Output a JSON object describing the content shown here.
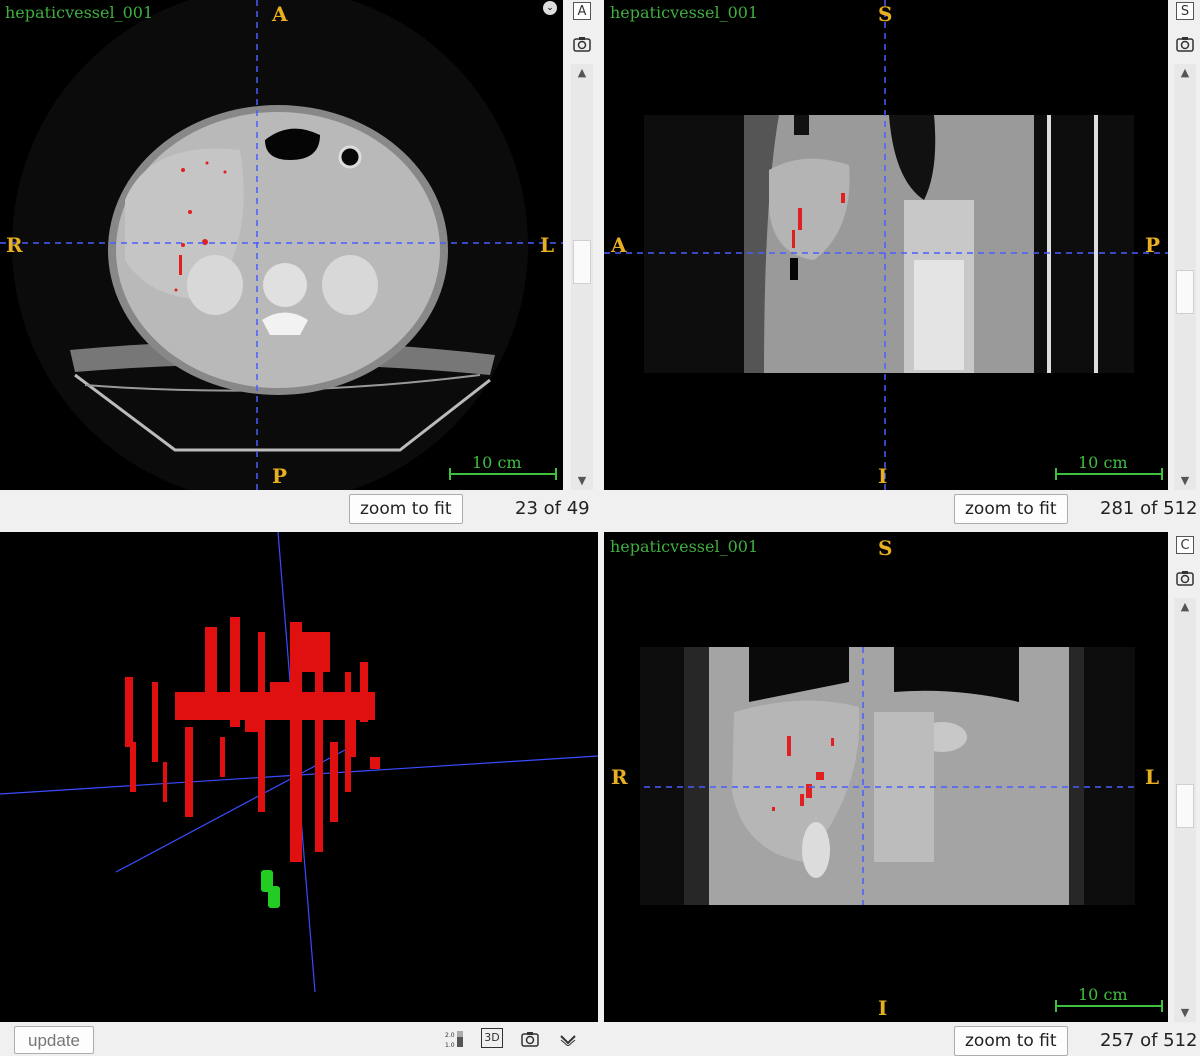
{
  "views": {
    "axial": {
      "volume_label": "hepaticvessel_001",
      "orient_top": "A",
      "orient_bottom": "P",
      "orient_left": "R",
      "orient_right": "L",
      "scale": "10 cm",
      "plane_button": "A",
      "zoom_label": "zoom to fit",
      "slice_counter": "23 of 49"
    },
    "sagittal": {
      "volume_label": "hepaticvessel_001",
      "orient_top": "S",
      "orient_bottom": "I",
      "orient_left": "A",
      "orient_right": "P",
      "scale": "10 cm",
      "plane_button": "S",
      "zoom_label": "zoom to fit",
      "slice_counter": "281 of 512"
    },
    "coronal": {
      "volume_label": "hepaticvessel_001",
      "orient_top": "S",
      "orient_bottom": "I",
      "orient_left": "R",
      "orient_right": "L",
      "scale": "10 cm",
      "plane_button": "C",
      "zoom_label": "zoom to fit",
      "slice_counter": "257 of 512"
    }
  },
  "render3d": {
    "update_label": "update",
    "toolbar": {
      "scale_icon_label": "2.0\n1.0",
      "button_3d": "3D"
    }
  },
  "colors": {
    "segmentation": "#ff1a1a",
    "tumor": "#22cc22",
    "crosshair": "#4a5cff",
    "orientation": "#e8b020",
    "label": "#3fae3f"
  }
}
